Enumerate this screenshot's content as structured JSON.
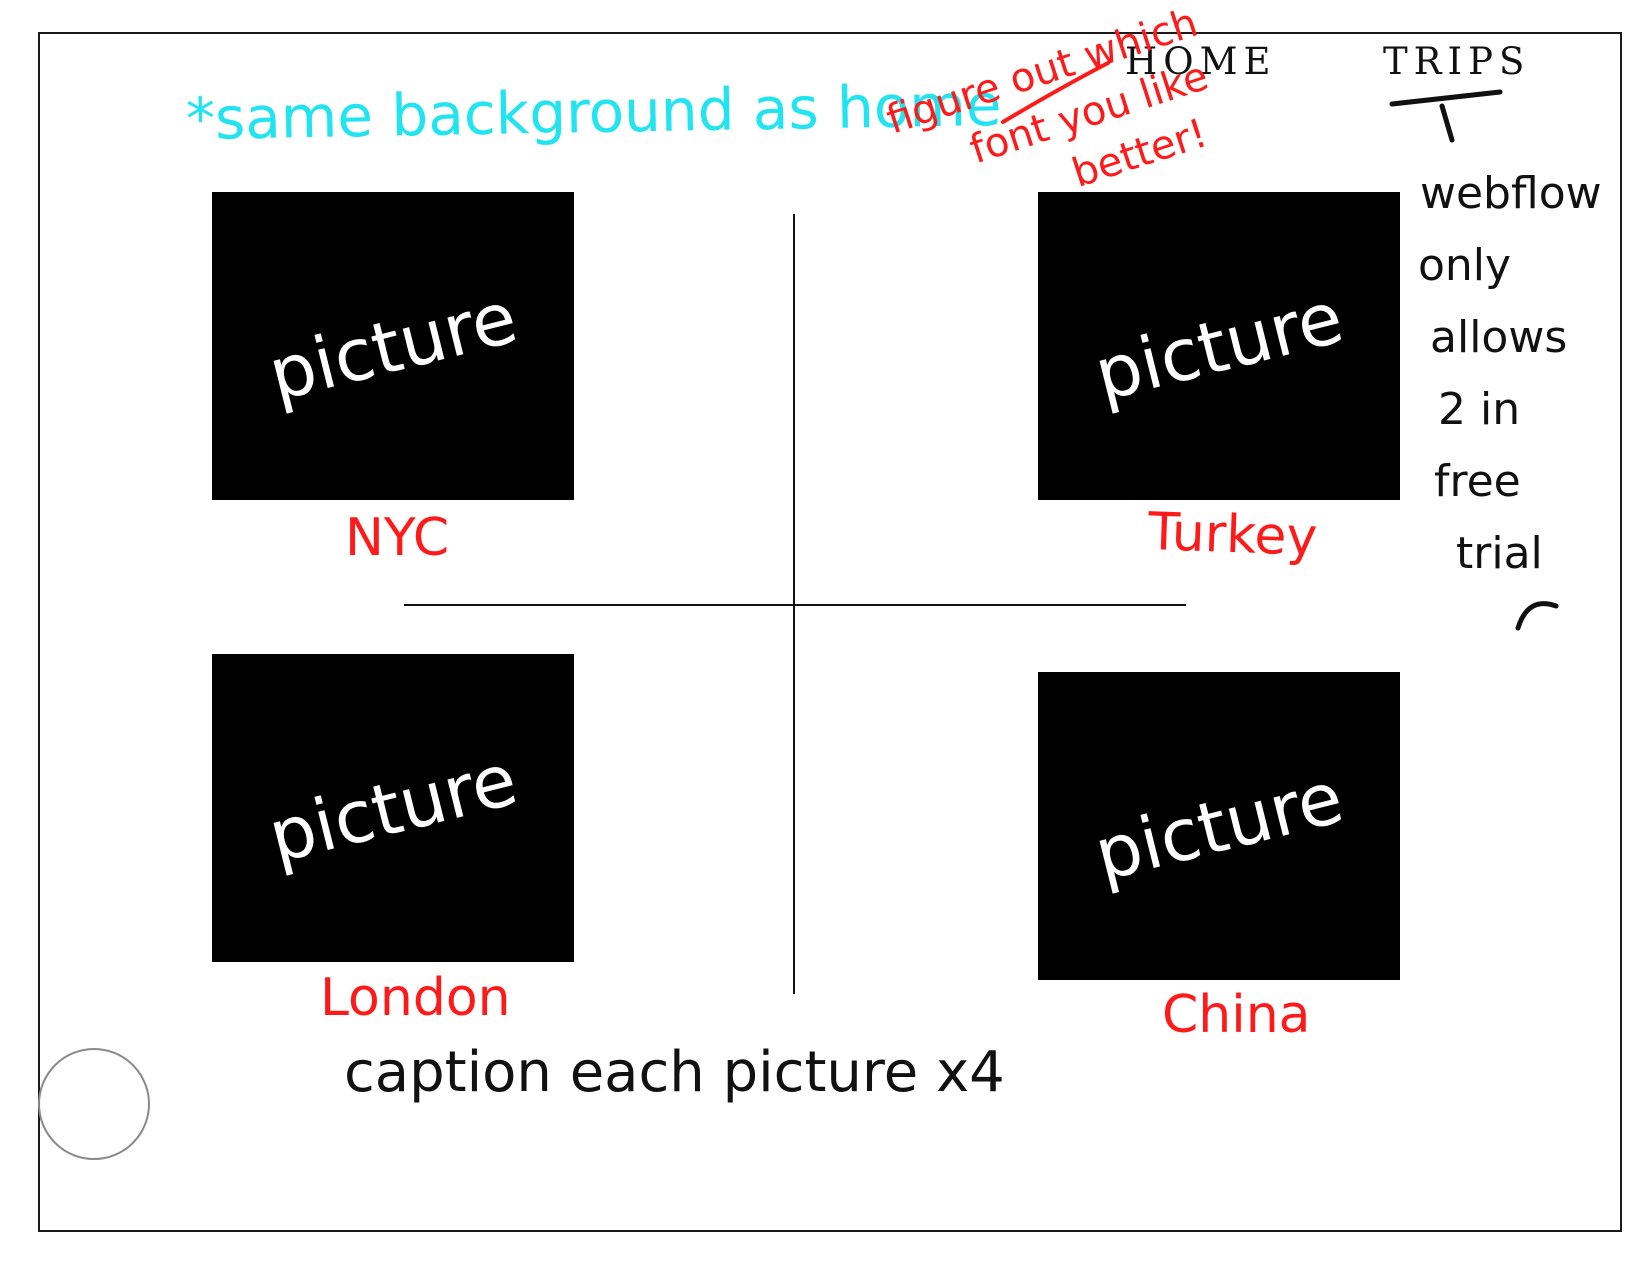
{
  "nav": {
    "home": "HOME",
    "trips": "TRIPS"
  },
  "notes": {
    "background": "*same background as home",
    "font": [
      "figure out which",
      "font you like",
      "better!"
    ],
    "webflow": [
      "webflow",
      "only",
      "allows",
      "2 in",
      "free",
      "trial"
    ],
    "caption": "caption each picture x4"
  },
  "pictures": [
    {
      "label": "picture",
      "caption": "NYC"
    },
    {
      "label": "picture",
      "caption": "Turkey"
    },
    {
      "label": "picture",
      "caption": "London"
    },
    {
      "label": "picture",
      "caption": "China"
    }
  ],
  "colors": {
    "cyan_note": "#22e4f0",
    "red_note": "#ff1a1a",
    "picture_fill": "#000000"
  }
}
